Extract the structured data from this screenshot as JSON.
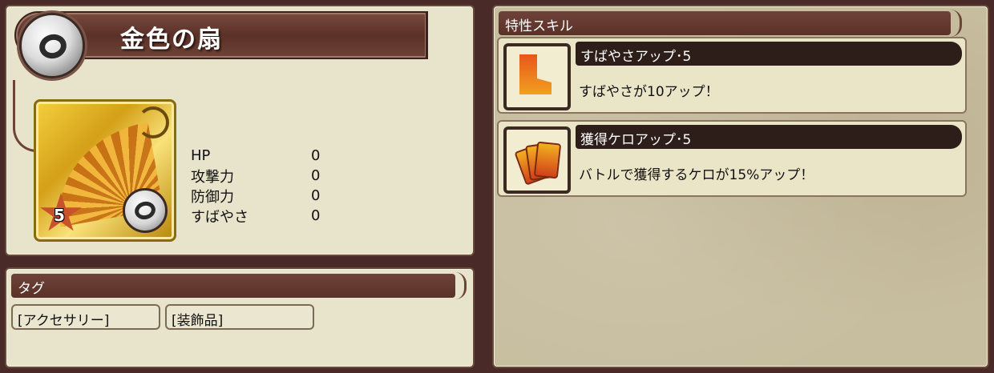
{
  "item": {
    "name": "金色の扇",
    "rarity": "5"
  },
  "stats": [
    {
      "label": "HP",
      "value": "0"
    },
    {
      "label": "攻撃力",
      "value": "0"
    },
    {
      "label": "防御力",
      "value": "0"
    },
    {
      "label": "すばやさ",
      "value": "0"
    }
  ],
  "tag_section": {
    "header": "タグ",
    "tags": [
      "[アクセサリー]",
      "[装飾品]"
    ]
  },
  "skill_section": {
    "header": "特性スキル",
    "skills": [
      {
        "name": "すばやさアップ･5",
        "desc": "すばやさが10アップ！",
        "icon": "boot-icon"
      },
      {
        "name": "獲得ケロアップ･5",
        "desc": "バトルで獲得するケロが15%アップ！",
        "icon": "cards-icon"
      }
    ]
  },
  "colors": {
    "panel_bg": "#e8e3cb",
    "header_bg": "#5a3128",
    "background": "#4a2a28",
    "gold": "#d4a017"
  }
}
